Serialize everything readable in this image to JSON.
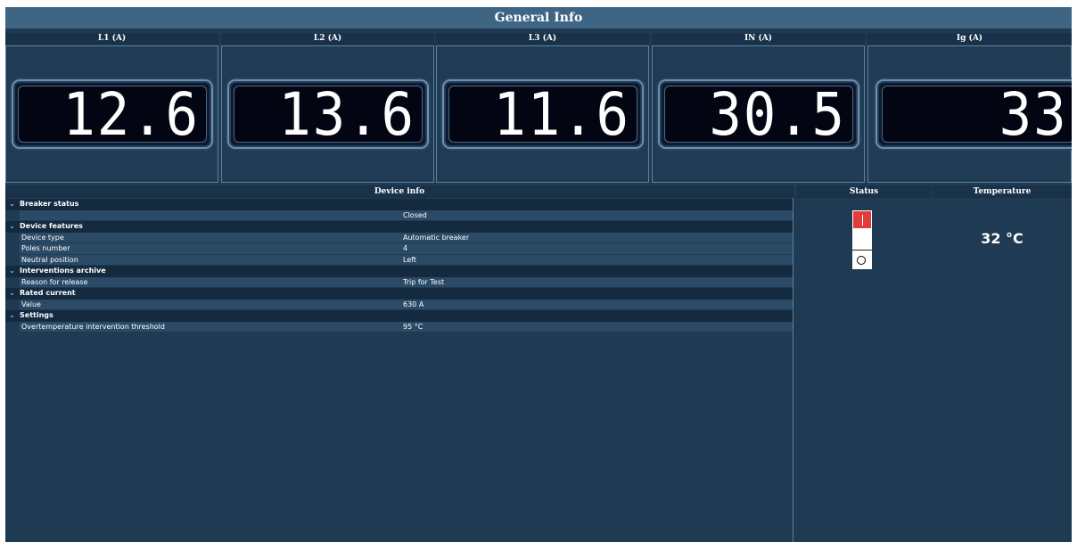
{
  "header": {
    "title": "General Info"
  },
  "meters": [
    {
      "label": "L1 (A)",
      "value": "12.6"
    },
    {
      "label": "L2 (A)",
      "value": "13.6"
    },
    {
      "label": "L3 (A)",
      "value": "11.6"
    },
    {
      "label": "IN (A)",
      "value": "30.5"
    },
    {
      "label": "Ig (A)",
      "value": "33"
    }
  ],
  "device_info": {
    "title": "Device info",
    "sections": [
      {
        "name": "Breaker status",
        "rows": [
          {
            "name": "",
            "value": "Closed"
          }
        ]
      },
      {
        "name": "Device features",
        "rows": [
          {
            "name": "Device type",
            "value": "Automatic breaker"
          },
          {
            "name": "Poles number",
            "value": "4"
          },
          {
            "name": "Neutral position",
            "value": "Left"
          }
        ]
      },
      {
        "name": "Interventions archive",
        "rows": [
          {
            "name": "Reason for release",
            "value": "Trip for Test"
          }
        ]
      },
      {
        "name": "Rated current",
        "rows": [
          {
            "name": "Value",
            "value": "630 A"
          }
        ]
      },
      {
        "name": "Settings",
        "rows": [
          {
            "name": "Overtemperature intervention threshold",
            "value": "95 °C"
          }
        ]
      }
    ]
  },
  "status": {
    "title": "Status",
    "breaker_state": "closed",
    "colors": {
      "on": "#e23b3b",
      "off": "#ffffff"
    }
  },
  "temperature": {
    "title": "Temperature",
    "value": "32 °C"
  },
  "icons": {
    "expand": "chevron-down-icon",
    "breaker_on": "breaker-on-icon",
    "breaker_off": "breaker-off-icon"
  }
}
